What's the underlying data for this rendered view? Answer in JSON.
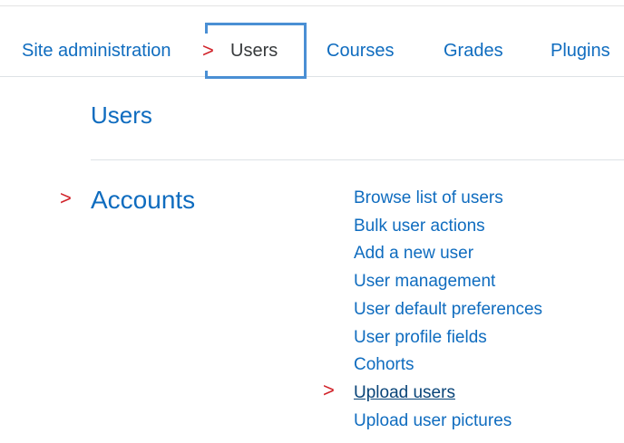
{
  "tabs": [
    {
      "label": "Site administration",
      "active": false
    },
    {
      "label": "Users",
      "active": true
    },
    {
      "label": "Courses",
      "active": false
    },
    {
      "label": "Grades",
      "active": false
    },
    {
      "label": "Plugins",
      "active": false
    }
  ],
  "markers": {
    "chevron": ">"
  },
  "section": {
    "title": "Users"
  },
  "category": {
    "title": "Accounts",
    "links": [
      "Browse list of users",
      "Bulk user actions",
      "Add a new user",
      "User management",
      "User default preferences",
      "User profile fields",
      "Cohorts",
      "Upload users",
      "Upload user pictures"
    ],
    "highlighted_link": "Upload users"
  },
  "colors": {
    "link": "#0f6cbf",
    "active_tab_text": "#373a3c",
    "marker_red": "#d1232a",
    "focus_box": "#4a8fd4"
  }
}
